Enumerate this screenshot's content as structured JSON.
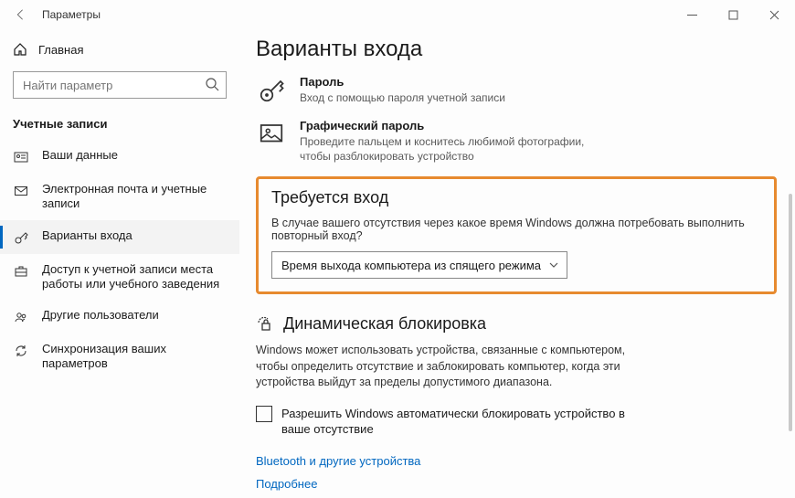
{
  "window": {
    "title": "Параметры"
  },
  "sidebar": {
    "home": "Главная",
    "search_placeholder": "Найти параметр",
    "section": "Учетные записи",
    "items": [
      {
        "label": "Ваши данные"
      },
      {
        "label": "Электронная почта и учетные записи"
      },
      {
        "label": "Варианты входа"
      },
      {
        "label": "Доступ к учетной записи места работы или учебного заведения"
      },
      {
        "label": "Другие пользователи"
      },
      {
        "label": "Синхронизация ваших параметров"
      }
    ]
  },
  "main": {
    "title": "Варианты входа",
    "options": [
      {
        "title": "Пароль",
        "desc": "Вход с помощью пароля учетной записи"
      },
      {
        "title": "Графический пароль",
        "desc": "Проведите пальцем и коснитесь любимой фотографии, чтобы разблокировать устройство"
      }
    ],
    "require": {
      "heading": "Требуется вход",
      "desc": "В случае вашего отсутствия через какое время Windows должна потребовать выполнить повторный вход?",
      "selected": "Время выхода компьютера из спящего режима"
    },
    "dynlock": {
      "heading": "Динамическая блокировка",
      "desc": "Windows может использовать устройства, связанные с компьютером, чтобы определить отсутствие и заблокировать компьютер, когда эти устройства выйдут за пределы допустимого диапазона.",
      "checkbox": "Разрешить Windows автоматически блокировать устройство в ваше отсутствие",
      "link1": "Bluetooth и другие устройства",
      "link2": "Подробнее"
    }
  }
}
